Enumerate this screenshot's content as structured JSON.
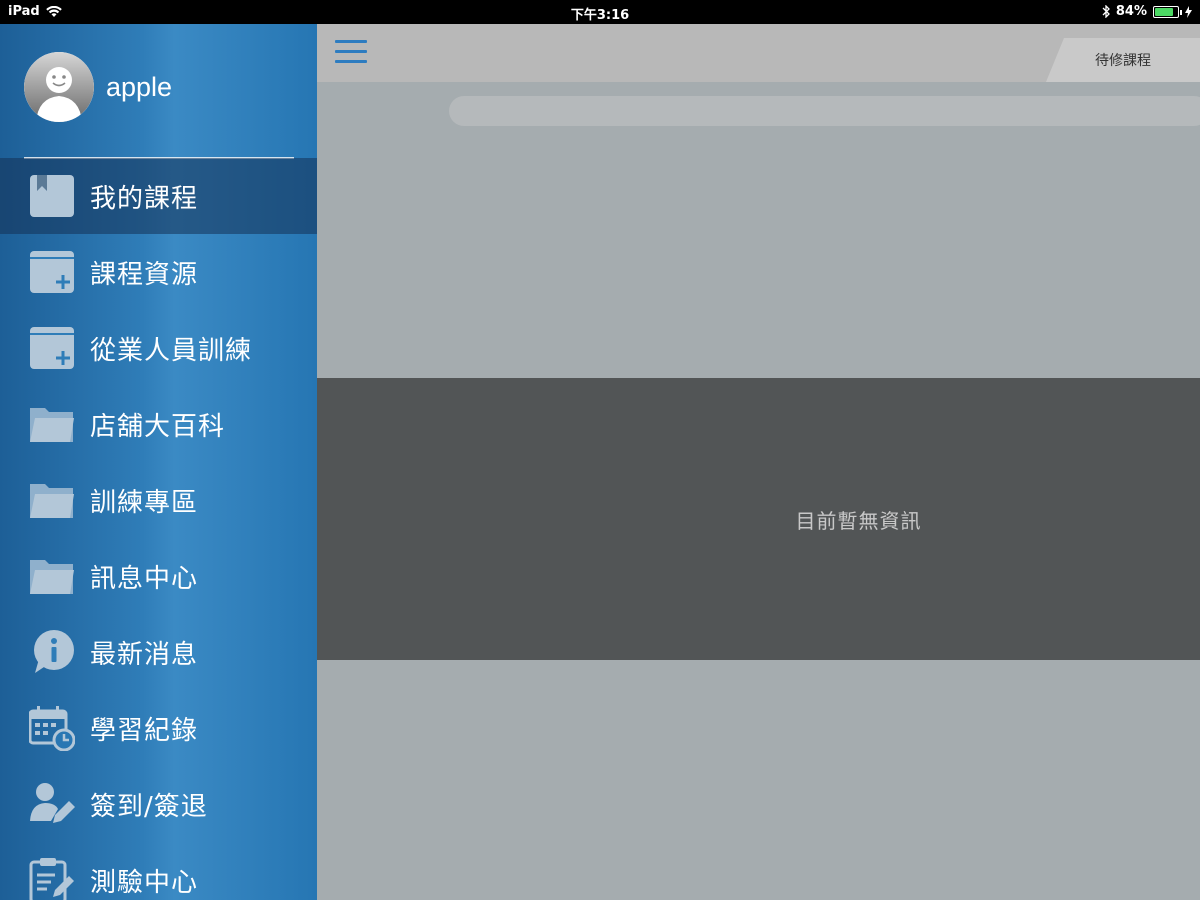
{
  "status_bar": {
    "device": "iPad",
    "time": "下午3:16",
    "battery": "84%",
    "battery_level": 0.84
  },
  "profile": {
    "username": "apple"
  },
  "sidebar": {
    "items": [
      {
        "label": "我的課程",
        "icon": "bookmark-book-icon"
      },
      {
        "label": "課程資源",
        "icon": "folder-add-icon"
      },
      {
        "label": "從業人員訓練",
        "icon": "folder-add-icon"
      },
      {
        "label": "店舖大百科",
        "icon": "folder-icon"
      },
      {
        "label": "訓練專區",
        "icon": "folder-icon"
      },
      {
        "label": "訊息中心",
        "icon": "folder-icon"
      },
      {
        "label": "最新消息",
        "icon": "info-bubble-icon"
      },
      {
        "label": "學習紀錄",
        "icon": "calendar-clock-icon"
      },
      {
        "label": "簽到/簽退",
        "icon": "user-edit-icon"
      },
      {
        "label": "測驗中心",
        "icon": "clipboard-edit-icon"
      }
    ],
    "active_index": 0
  },
  "header": {
    "tab_label": "待修課程"
  },
  "main": {
    "empty_message": "目前暫無資訊"
  },
  "colors": {
    "accent": "#2d7cc0",
    "sidebar": "#2f7db8",
    "panel": "#525556"
  }
}
